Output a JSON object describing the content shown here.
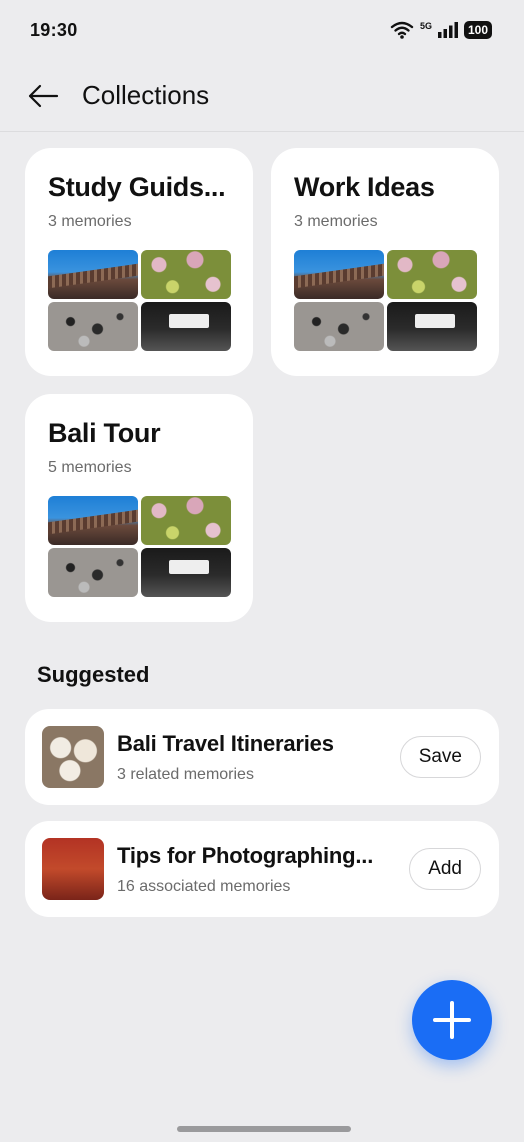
{
  "status": {
    "time": "19:30",
    "network": "5G",
    "battery": "100"
  },
  "header": {
    "title": "Collections",
    "back_icon": "arrow-left-icon"
  },
  "collections": [
    {
      "title": "Study Guids...",
      "count": "3 memories"
    },
    {
      "title": "Work Ideas",
      "count": "3 memories"
    },
    {
      "title": "Bali Tour",
      "count": "5 memories"
    }
  ],
  "suggested": {
    "title": "Suggested",
    "items": [
      {
        "title": "Bali Travel Itineraries",
        "subtitle": "3 related memories",
        "action": "Save"
      },
      {
        "title": "Tips for Photographing...",
        "subtitle": "16 associated memories",
        "action": "Add"
      }
    ]
  },
  "fab": {
    "icon": "plus-icon"
  },
  "colors": {
    "accent": "#1a6df5",
    "background": "#ececee",
    "card": "#ffffff"
  }
}
